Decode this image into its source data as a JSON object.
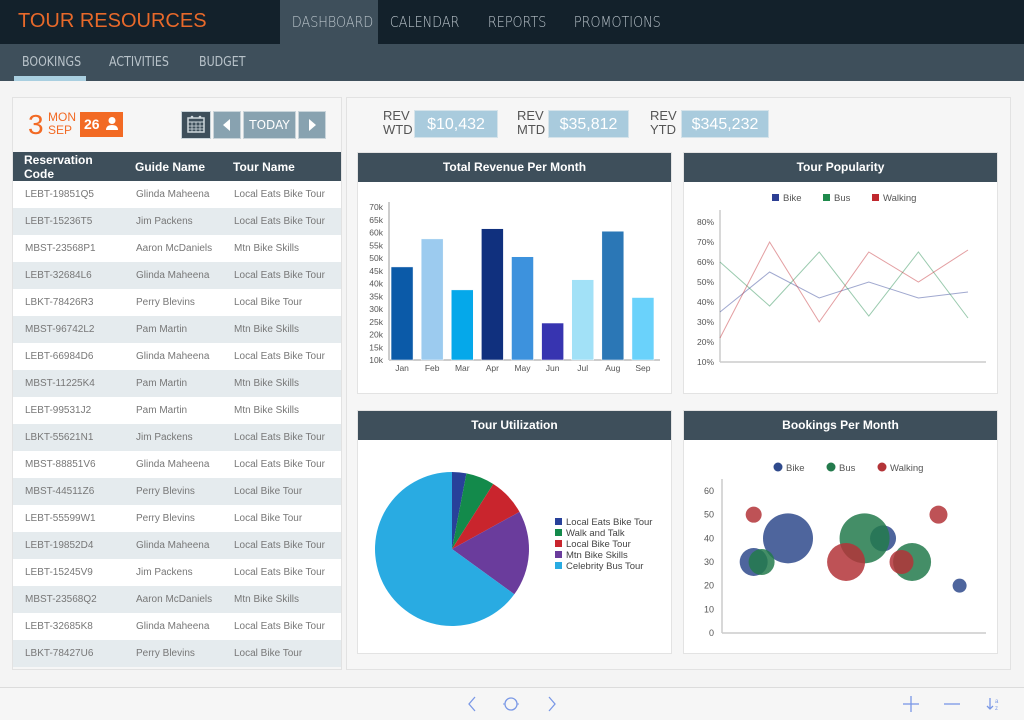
{
  "app": {
    "title": "TOUR RESOURCES",
    "brand_color": "#e8692a"
  },
  "main_nav": [
    {
      "label": "DASHBOARD",
      "active": true
    },
    {
      "label": "CALENDAR",
      "active": false
    },
    {
      "label": "REPORTS",
      "active": false
    },
    {
      "label": "PROMOTIONS",
      "active": false
    }
  ],
  "sub_nav": [
    {
      "label": "BOOKINGS",
      "active": true
    },
    {
      "label": "ACTIVITIES",
      "active": false
    },
    {
      "label": "BUDGET",
      "active": false
    }
  ],
  "date": {
    "day": "3",
    "weekday": "MON",
    "month": "SEP",
    "guest_count": "26"
  },
  "date_controls": {
    "calendar_icon": "calendar-icon",
    "prev_icon": "triangle-left-icon",
    "today_label": "TODAY",
    "next_icon": "triangle-right-icon"
  },
  "reservations": {
    "columns": [
      "Reservation Code",
      "Guide Name",
      "Tour Name"
    ],
    "rows": [
      [
        "LEBT-19851Q5",
        "Glinda Maheena",
        "Local Eats Bike Tour"
      ],
      [
        "LEBT-15236T5",
        "Jim Packens",
        "Local Eats Bike Tour"
      ],
      [
        "MBST-23568P1",
        "Aaron McDaniels",
        "Mtn Bike Skills"
      ],
      [
        "LEBT-32684L6",
        "Glinda Maheena",
        "Local Eats Bike Tour"
      ],
      [
        "LBKT-78426R3",
        "Perry Blevins",
        "Local Bike Tour"
      ],
      [
        "MBST-96742L2",
        "Pam Martin",
        "Mtn Bike Skills"
      ],
      [
        "LEBT-66984D6",
        "Glinda Maheena",
        "Local Eats Bike Tour"
      ],
      [
        "MBST-11225K4",
        "Pam Martin",
        "Mtn Bike Skills"
      ],
      [
        "LEBT-99531J2",
        "Pam Martin",
        "Mtn Bike Skills"
      ],
      [
        "LBKT-55621N1",
        "Jim Packens",
        "Local Eats Bike Tour"
      ],
      [
        "MBST-88851V6",
        "Glinda Maheena",
        "Local Eats Bike Tour"
      ],
      [
        "MBST-44511Z6",
        "Perry Blevins",
        "Local Bike Tour"
      ],
      [
        "LEBT-55599W1",
        "Perry Blevins",
        "Local Bike Tour"
      ],
      [
        "LEBT-19852D4",
        "Glinda Maheena",
        "Local Eats Bike Tour"
      ],
      [
        "LEBT-15245V9",
        "Jim Packens",
        "Local Eats Bike Tour"
      ],
      [
        "MBST-23568Q2",
        "Aaron McDaniels",
        "Mtn Bike Skills"
      ],
      [
        "LEBT-32685K8",
        "Glinda Maheena",
        "Local Eats Bike Tour"
      ],
      [
        "LBKT-78427U6",
        "Perry Blevins",
        "Local Bike Tour"
      ]
    ]
  },
  "revenue_kpis": [
    {
      "label_top": "REV",
      "label_bottom": "WTD",
      "value": "$10,432"
    },
    {
      "label_top": "REV",
      "label_bottom": "MTD",
      "value": "$35,812"
    },
    {
      "label_top": "REV",
      "label_bottom": "YTD",
      "value": "$345,232"
    }
  ],
  "footer": {
    "icons": [
      "chevron-left-icon",
      "circle-icon",
      "chevron-right-icon",
      "plus-icon",
      "minus-icon",
      "sort-az-icon"
    ]
  },
  "chart_data": [
    {
      "type": "bar",
      "title": "Total Revenue Per Month",
      "categories": [
        "Jan",
        "Feb",
        "Mar",
        "Apr",
        "May",
        "Jun",
        "Jul",
        "Aug",
        "Sep"
      ],
      "values": [
        46500,
        57500,
        37500,
        61500,
        50500,
        24500,
        41500,
        60500,
        34500
      ],
      "colors": [
        "#0b5aa8",
        "#9ccbef",
        "#05a8ea",
        "#10307e",
        "#3d92dd",
        "#3734b0",
        "#a2e1f7",
        "#2b77b6",
        "#6ad2fb"
      ],
      "ylim": [
        10000,
        70000
      ],
      "yticks": [
        "10k",
        "15k",
        "20k",
        "25k",
        "30k",
        "35k",
        "40k",
        "45k",
        "50k",
        "55k",
        "60k",
        "65k",
        "70k"
      ],
      "xlabel": "",
      "ylabel": "",
      "grid": false
    },
    {
      "type": "line",
      "title": "Tour Popularity",
      "legend_position": "top",
      "ylim": [
        10,
        80
      ],
      "yticks": [
        "10%",
        "20%",
        "30%",
        "40%",
        "50%",
        "60%",
        "70%",
        "80%"
      ],
      "series": [
        {
          "name": "Bike",
          "color": "#2d3f94",
          "values": [
            35,
            55,
            42,
            50,
            42,
            45
          ]
        },
        {
          "name": "Bus",
          "color": "#1f8a4c",
          "values": [
            60,
            38,
            65,
            33,
            65,
            32
          ]
        },
        {
          "name": "Walking",
          "color": "#c0282e",
          "values": [
            22,
            70,
            30,
            65,
            50,
            66
          ]
        }
      ],
      "grid": false
    },
    {
      "type": "pie",
      "title": "Tour Utilization",
      "legend_position": "right",
      "slices": [
        {
          "label": "Local Eats Bike Tour",
          "value": 3,
          "color": "#28419a"
        },
        {
          "label": "Walk and Talk",
          "value": 6,
          "color": "#138a4b"
        },
        {
          "label": "Local Bike Tour",
          "value": 8,
          "color": "#c9252d"
        },
        {
          "label": "Mtn Bike Skills",
          "value": 18,
          "color": "#6a3c9c"
        },
        {
          "label": "Celebrity Bus Tour",
          "value": 65,
          "color": "#29abe2"
        }
      ]
    },
    {
      "type": "scatter",
      "subtype": "bubble",
      "title": "Bookings Per Month",
      "legend_position": "top",
      "ylim": [
        0,
        60
      ],
      "yticks": [
        "0",
        "10",
        "20",
        "30",
        "40",
        "50",
        "60"
      ],
      "xlim": [
        0,
        100
      ],
      "series": [
        {
          "name": "Bike",
          "color": "#2f4a8c",
          "points": [
            {
              "x": 12,
              "y": 30,
              "size": 14
            },
            {
              "x": 25,
              "y": 40,
              "size": 25
            },
            {
              "x": 61,
              "y": 40,
              "size": 13
            },
            {
              "x": 90,
              "y": 20,
              "size": 7
            }
          ]
        },
        {
          "name": "Bus",
          "color": "#237a4c",
          "points": [
            {
              "x": 15,
              "y": 30,
              "size": 13
            },
            {
              "x": 54,
              "y": 40,
              "size": 25
            },
            {
              "x": 72,
              "y": 30,
              "size": 19
            }
          ]
        },
        {
          "name": "Walking",
          "color": "#b33438",
          "points": [
            {
              "x": 12,
              "y": 50,
              "size": 8
            },
            {
              "x": 47,
              "y": 30,
              "size": 19
            },
            {
              "x": 68,
              "y": 30,
              "size": 12
            },
            {
              "x": 82,
              "y": 50,
              "size": 9
            }
          ]
        }
      ],
      "grid": false
    }
  ]
}
